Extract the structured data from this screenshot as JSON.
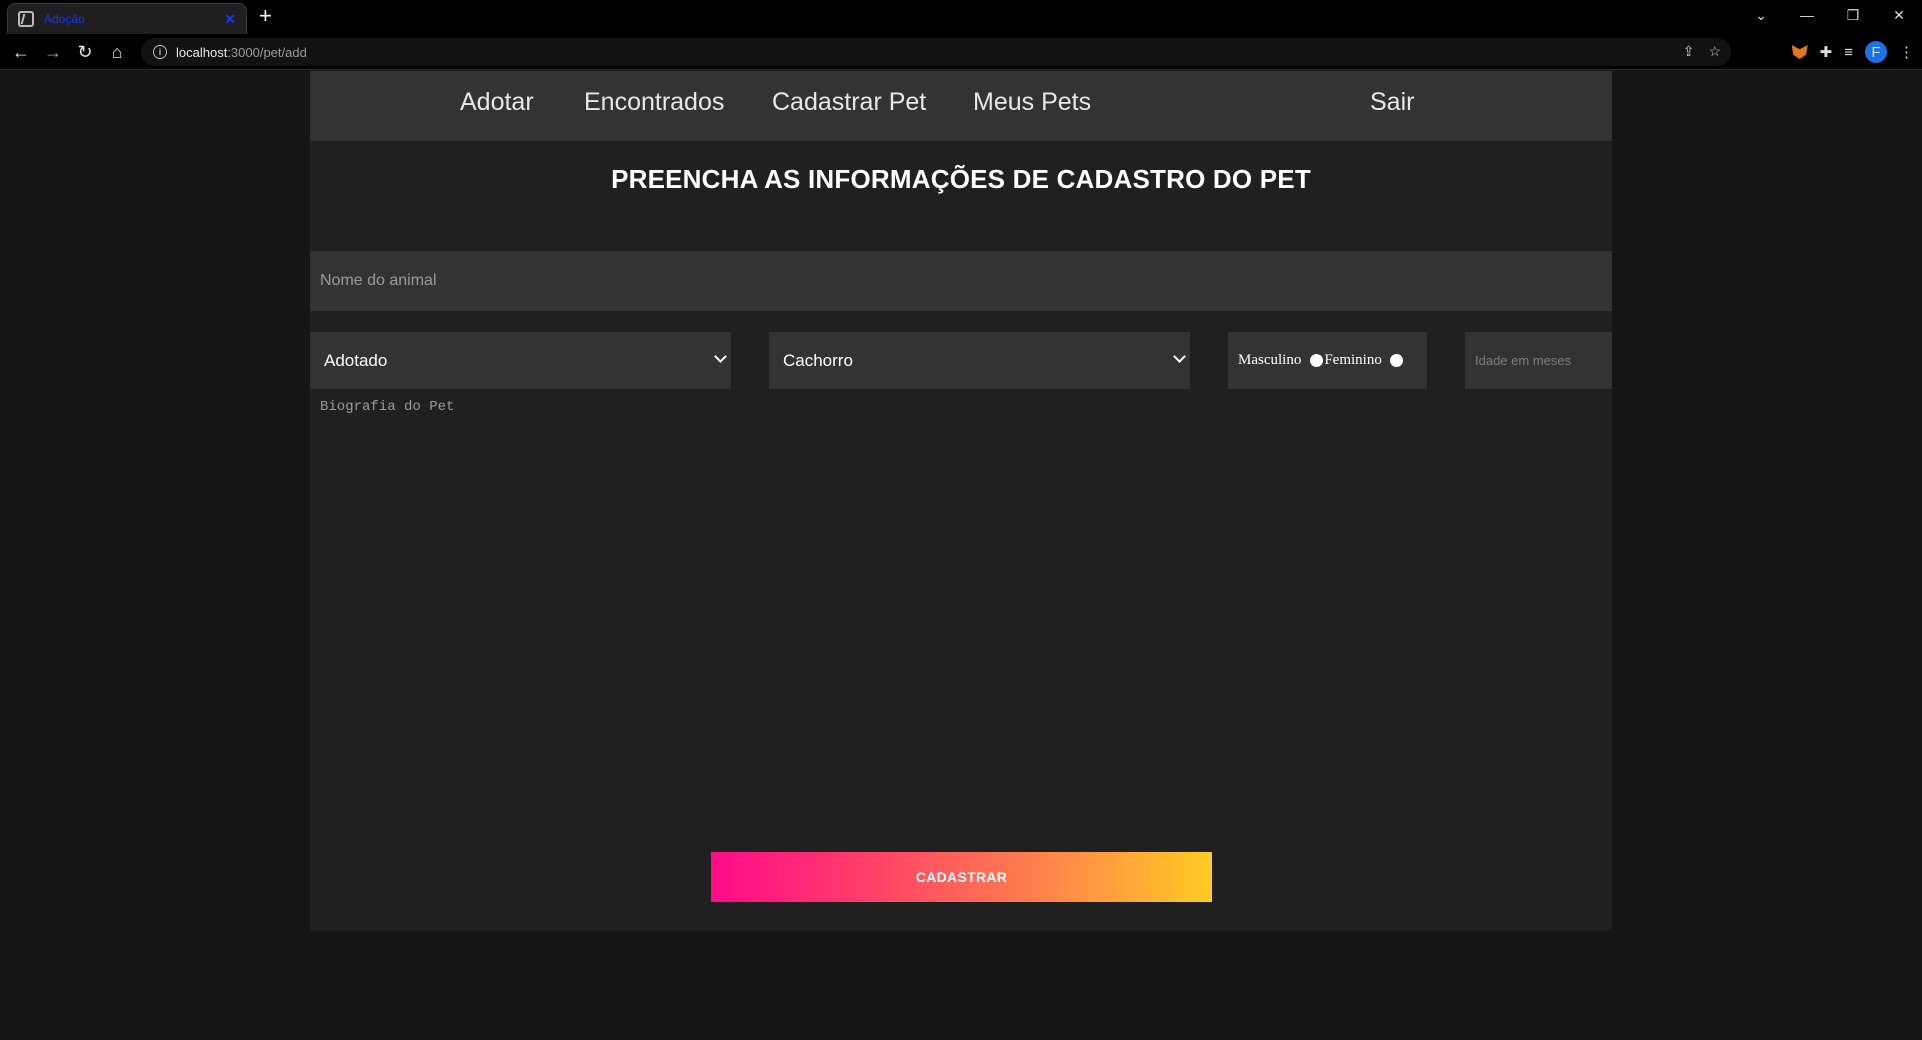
{
  "browser": {
    "tab_title": "Adoção",
    "url_host": "localhost",
    "url_path": ":3000/pet/add",
    "profile_initial": "F"
  },
  "nav": {
    "adotar": "Adotar",
    "encontrados": "Encontrados",
    "cadastrar_pet": "Cadastrar Pet",
    "meus_pets": "Meus Pets",
    "sair": "Sair"
  },
  "form": {
    "heading": "PREENCHA AS INFORMAÇÕES DE CADASTRO DO PET",
    "name_placeholder": "Nome do animal",
    "status_selected": "Adotado",
    "species_selected": "Cachorro",
    "gender_male": "Masculino",
    "gender_female": "Feminino",
    "age_placeholder": "Idade em meses",
    "bio_placeholder": "Biografia do Pet",
    "submit_label": "CADASTRAR"
  },
  "colors": {
    "gradient_start": "#ff0b8a",
    "gradient_end": "#ffcc22"
  }
}
